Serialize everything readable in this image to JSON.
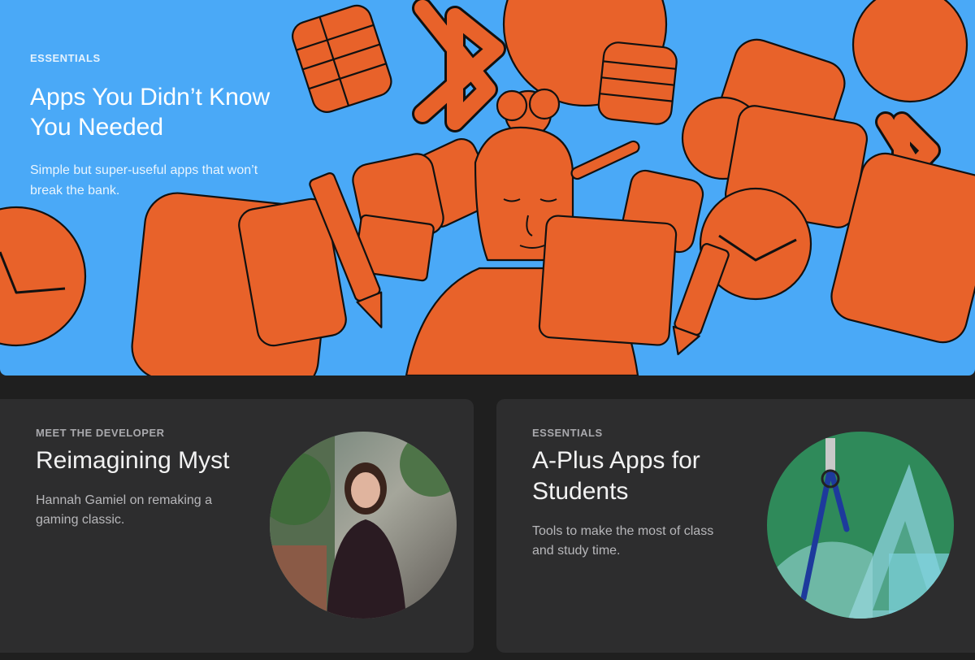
{
  "hero": {
    "eyebrow": "ESSENTIALS",
    "title_line1": "Apps You Didn’t Know",
    "title_line2": "You Needed",
    "subtitle_line1": "Simple but super-useful apps that won’t",
    "subtitle_line2": "break the bank.",
    "background": "#4aa9f7",
    "accent": "#e8622a"
  },
  "cards": [
    {
      "eyebrow": "MEET THE DEVELOPER",
      "title": "Reimagining Myst",
      "subtitle_line1": "Hannah Gamiel on remaking a",
      "subtitle_line2": "gaming classic."
    },
    {
      "eyebrow": "ESSENTIALS",
      "title_line1": "A-Plus Apps for",
      "title_line2": "Students",
      "subtitle_line1": "Tools to make the most of class",
      "subtitle_line2": "and study time."
    }
  ],
  "colors": {
    "page_bg": "#1f1f1f",
    "card_bg": "#2d2d2e"
  }
}
